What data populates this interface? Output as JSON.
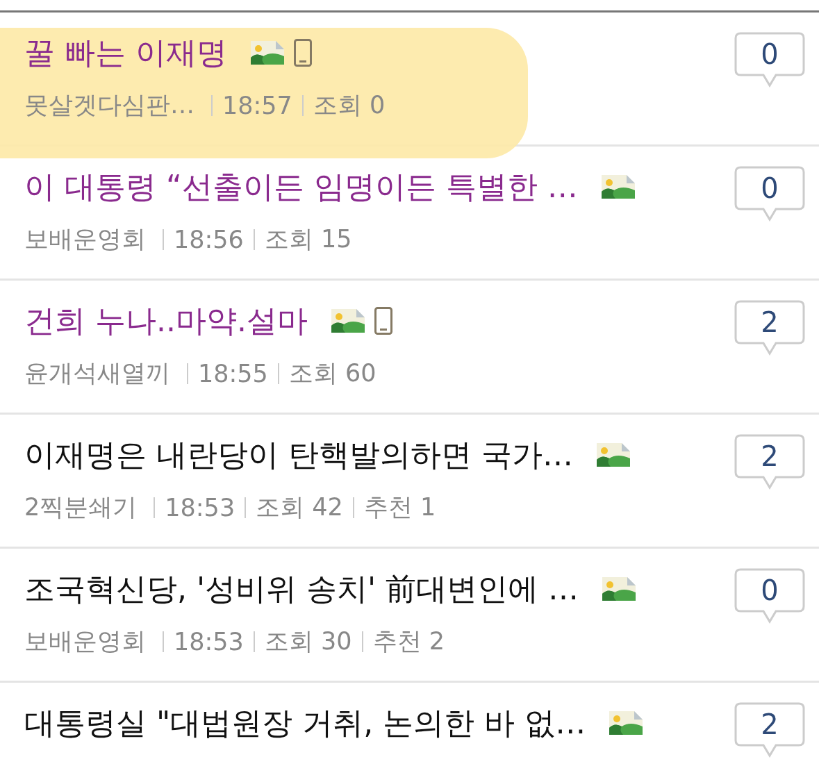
{
  "posts": [
    {
      "title": "꿀 빠는 이재명",
      "visited": true,
      "highlighted": true,
      "has_image": true,
      "mobile": true,
      "author": "못살겟다심판…",
      "time": "18:57",
      "views": "조회 0",
      "comments": "0"
    },
    {
      "title": "이 대통령 “선출이든 임명이든 특별한 …",
      "visited": true,
      "highlighted": false,
      "has_image": true,
      "mobile": false,
      "author": "보배운영회",
      "time": "18:56",
      "views": "조회 15",
      "comments": "0"
    },
    {
      "title": "건희 누나..마약.설마",
      "visited": true,
      "highlighted": false,
      "has_image": true,
      "mobile": true,
      "author": "윤개석새열끼",
      "time": "18:55",
      "views": "조회 60",
      "comments": "2"
    },
    {
      "title": "이재명은 내란당이 탄핵발의하면 국가…",
      "visited": false,
      "highlighted": false,
      "has_image": true,
      "mobile": false,
      "author": "2찍분쇄기",
      "time": "18:53",
      "views": "조회 42",
      "likes": "추천 1",
      "comments": "2"
    },
    {
      "title": "조국혁신당, '성비위 송치' 前대변인에 …",
      "visited": false,
      "highlighted": false,
      "has_image": true,
      "mobile": false,
      "author": "보배운영회",
      "time": "18:53",
      "views": "조회 30",
      "likes": "추천 2",
      "comments": "0"
    },
    {
      "title": "대통령실 \"대법원장 거취, 논의한 바 없…",
      "visited": false,
      "highlighted": false,
      "has_image": true,
      "mobile": false,
      "comments": "2"
    }
  ]
}
